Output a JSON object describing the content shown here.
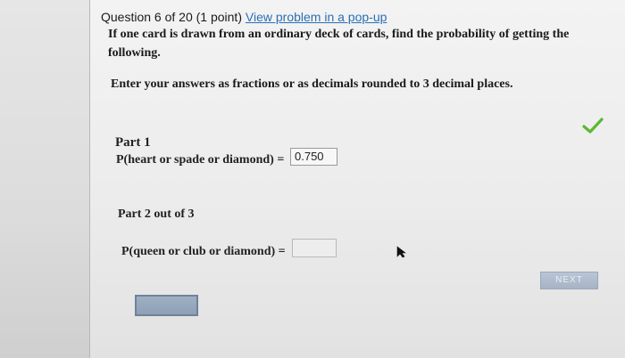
{
  "header": {
    "question_text": "Question 6 of 20 (1 point)",
    "popup_link": "View problem in a pop-up"
  },
  "problem": {
    "prompt": "If one card is drawn from an ordinary deck of cards, find the probability of getting the following.",
    "instructions": "Enter your answers as fractions or as decimals rounded to 3 decimal places."
  },
  "part1": {
    "label": "Part 1",
    "expression": "P(heart or spade or diamond) =",
    "answer": "0.750",
    "status_icon": "green-check-icon",
    "status_color": "#5cb82e"
  },
  "part2": {
    "label": "Part 2 out of 3",
    "expression": "P(queen or club or diamond) =",
    "answer": ""
  },
  "buttons": {
    "next_label": "NEXT",
    "submit_label": ""
  }
}
